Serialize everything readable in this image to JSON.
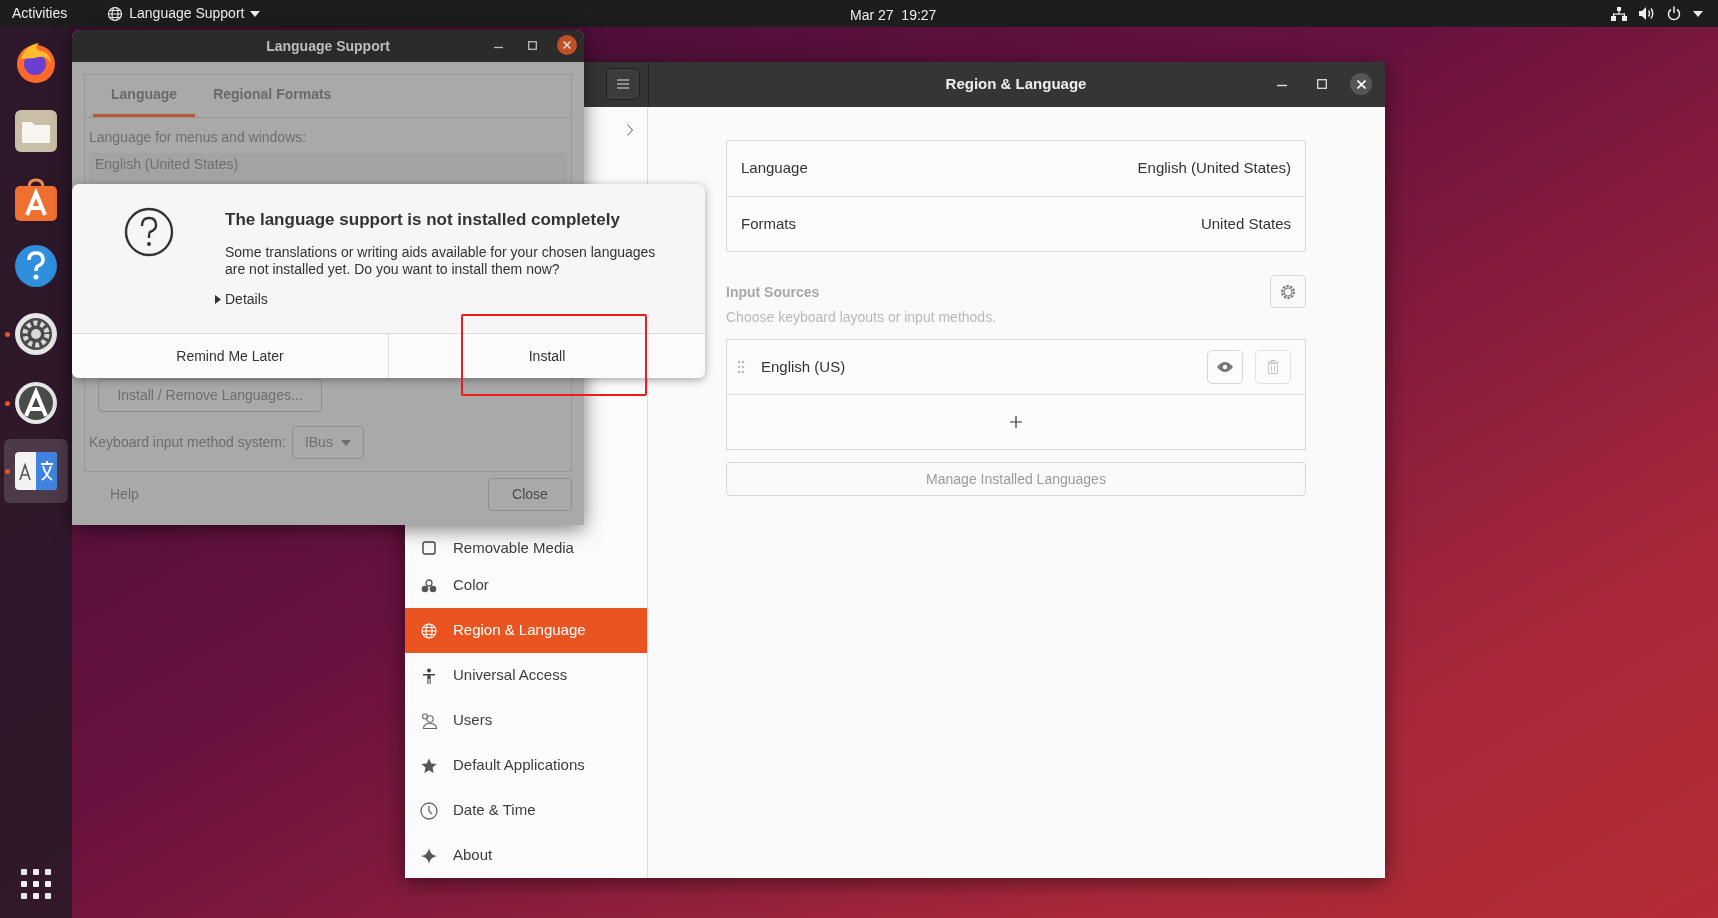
{
  "top_bar": {
    "activities": "Activities",
    "app_menu": "Language Support",
    "clock": "Mar 27  19:27"
  },
  "dock": {
    "items": [
      {
        "running": false,
        "selected": false
      },
      {
        "running": false,
        "selected": false
      },
      {
        "running": false,
        "selected": false
      },
      {
        "running": false,
        "selected": false
      },
      {
        "running": true,
        "selected": false
      },
      {
        "running": true,
        "selected": false
      },
      {
        "running": true,
        "selected": true
      }
    ]
  },
  "language_support": {
    "title": "Language Support",
    "tabs": [
      {
        "label": "Language",
        "selected": true
      },
      {
        "label": "Regional Formats",
        "selected": false
      }
    ],
    "list_label": "Language for menus and windows:",
    "languages": [
      "English (United States)"
    ],
    "install_remove_button": "Install / Remove Languages...",
    "input_method_label": "Keyboard input method system:",
    "input_method_value": "IBus",
    "help_button": "Help",
    "close_button": "Close"
  },
  "dialog": {
    "title": "The language support is not installed completely",
    "message": "Some translations or writing aids available for your chosen languages are not installed yet. Do you want to install them now?",
    "details": "Details",
    "buttons": [
      "Remind Me Later",
      "Install"
    ]
  },
  "region_window": {
    "title": "Region & Language",
    "sidebar": [
      {
        "label": "Removable Media",
        "selected": false
      },
      {
        "label": "Color",
        "selected": false
      },
      {
        "label": "Region & Language",
        "selected": true
      },
      {
        "label": "Universal Access",
        "selected": false
      },
      {
        "label": "Users",
        "selected": false
      },
      {
        "label": "Default Applications",
        "selected": false
      },
      {
        "label": "Date & Time",
        "selected": false
      },
      {
        "label": "About",
        "selected": false
      }
    ],
    "settings": [
      {
        "label": "Language",
        "value": "English (United States)"
      },
      {
        "label": "Formats",
        "value": "United States"
      }
    ],
    "input_sources_title": "Input Sources",
    "input_sources_subtitle": "Choose keyboard layouts or input methods.",
    "input_sources": [
      {
        "name": "English (US)"
      }
    ],
    "manage_button": "Manage Installed Languages"
  }
}
